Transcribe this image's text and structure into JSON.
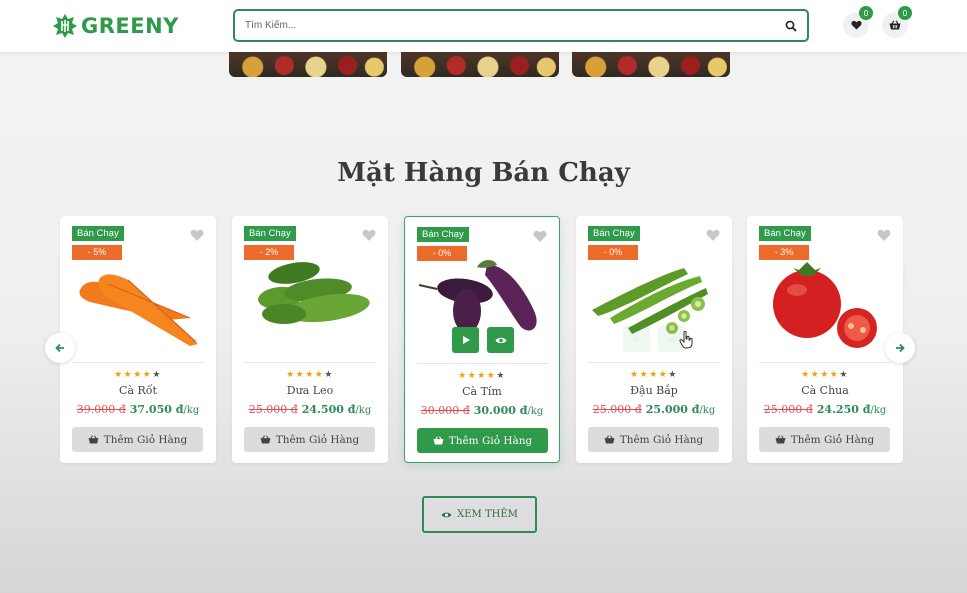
{
  "header": {
    "logo_text": "GREENY",
    "search_placeholder": "Tìm Kiếm...",
    "wishlist_count": "0",
    "cart_count": "0"
  },
  "section_title": "Mặt Hàng Bán Chạy",
  "colors": {
    "brand_green": "#2e9a4a",
    "discount_orange": "#ec6a2a",
    "old_price_red": "#e05050"
  },
  "products": [
    {
      "tag": "Bán Chạy",
      "discount": "- 5%",
      "rating": 4,
      "name": "Cà Rốt",
      "old_price": "39.000 đ",
      "new_price": "37.050 đ",
      "unit": "/kg",
      "add_label": "Thêm Giỏ Hàng"
    },
    {
      "tag": "Bán Chạy",
      "discount": "- 2%",
      "rating": 4,
      "name": "Dưa Leo",
      "old_price": "25.000 đ",
      "new_price": "24.500 đ",
      "unit": "/kg",
      "add_label": "Thêm Giỏ Hàng"
    },
    {
      "tag": "Bán Chạy",
      "discount": "- 0%",
      "rating": 4,
      "name": "Cà Tím",
      "old_price": "30.000 đ",
      "new_price": "30.000 đ",
      "unit": "/kg",
      "add_label": "Thêm Giỏ Hàng"
    },
    {
      "tag": "Bán Chạy",
      "discount": "- 0%",
      "rating": 4,
      "name": "Đậu Bắp",
      "old_price": "25.000 đ",
      "new_price": "25.000 đ",
      "unit": "/kg",
      "add_label": "Thêm Giỏ Hàng"
    },
    {
      "tag": "Bán Chạy",
      "discount": "- 3%",
      "rating": 4,
      "name": "Cà Chua",
      "old_price": "25.000 đ",
      "new_price": "24.250 đ",
      "unit": "/kg",
      "add_label": "Thêm Giỏ Hàng"
    }
  ],
  "view_more_label": "XEM THÊM"
}
